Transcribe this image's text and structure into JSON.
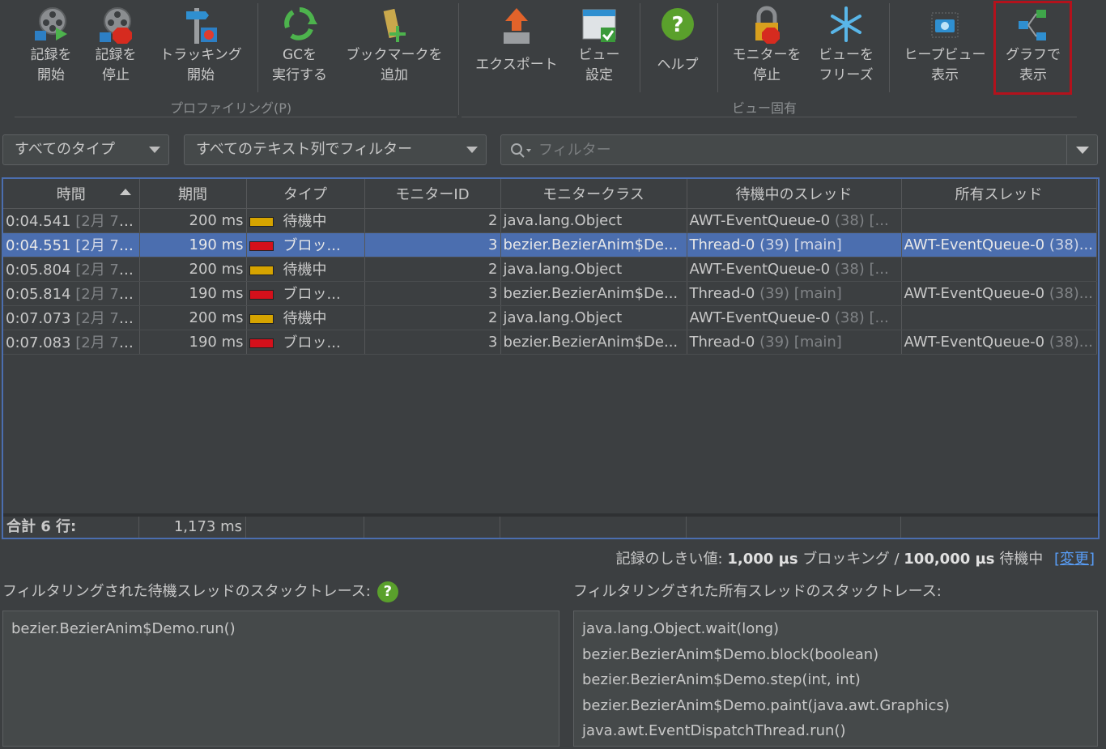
{
  "toolbar": {
    "start_recording": "記録を\n開始",
    "stop_recording": "記録を\n停止",
    "start_tracking": "トラッキング\n開始",
    "run_gc": "GCを\n実行する",
    "add_bookmark": "ブックマークを\n追加",
    "export": "エクスポート",
    "view_settings": "ビュー\n設定",
    "help": "ヘルプ",
    "stop_monitor": "モニターを\n停止",
    "freeze_view": "ビューを\nフリーズ",
    "show_heap_view": "ヒープビュー\n表示",
    "show_graph": "グラフで\n表示",
    "group_profiling": "プロファイリング(P)",
    "group_view_specific": "ビュー固有"
  },
  "filters": {
    "type_select": "すべてのタイプ",
    "text_column_select": "すべてのテキスト列でフィルター",
    "search_placeholder": "フィルター"
  },
  "table": {
    "columns": [
      "時間",
      "期間",
      "タイプ",
      "モニターID",
      "モニタークラス",
      "待機中のスレッド",
      "所有スレッド"
    ],
    "rows": [
      {
        "time": "0:04.541",
        "date": "[2月 7, ...",
        "duration": "200 ms",
        "type": "wait",
        "type_label": "待機中",
        "monitor_id": "2",
        "monitor_class": "java.lang.Object",
        "waiting_thread": "AWT-EventQueue-0",
        "waiting_extra": "(38) [...",
        "owning_thread": "",
        "owning_extra": "",
        "selected": false
      },
      {
        "time": "0:04.551",
        "date": "[2月 7, ...",
        "duration": "190 ms",
        "type": "block",
        "type_label": "ブロッ...",
        "monitor_id": "3",
        "monitor_class": "bezier.BezierAnim$De...",
        "waiting_thread": "Thread-0",
        "waiting_extra": "(39) [main]",
        "owning_thread": "AWT-EventQueue-0",
        "owning_extra": "(38)...",
        "selected": true
      },
      {
        "time": "0:05.804",
        "date": "[2月 7, ...",
        "duration": "200 ms",
        "type": "wait",
        "type_label": "待機中",
        "monitor_id": "2",
        "monitor_class": "java.lang.Object",
        "waiting_thread": "AWT-EventQueue-0",
        "waiting_extra": "(38) [...",
        "owning_thread": "",
        "owning_extra": "",
        "selected": false
      },
      {
        "time": "0:05.814",
        "date": "[2月 7, ...",
        "duration": "190 ms",
        "type": "block",
        "type_label": "ブロッ...",
        "monitor_id": "3",
        "monitor_class": "bezier.BezierAnim$De...",
        "waiting_thread": "Thread-0",
        "waiting_extra": "(39) [main]",
        "owning_thread": "AWT-EventQueue-0",
        "owning_extra": "(38)...",
        "selected": false
      },
      {
        "time": "0:07.073",
        "date": "[2月 7, ...",
        "duration": "200 ms",
        "type": "wait",
        "type_label": "待機中",
        "monitor_id": "2",
        "monitor_class": "java.lang.Object",
        "waiting_thread": "AWT-EventQueue-0",
        "waiting_extra": "(38) [...",
        "owning_thread": "",
        "owning_extra": "",
        "selected": false
      },
      {
        "time": "0:07.083",
        "date": "[2月 7, ...",
        "duration": "190 ms",
        "type": "block",
        "type_label": "ブロッ...",
        "monitor_id": "3",
        "monitor_class": "bezier.BezierAnim$De...",
        "waiting_thread": "Thread-0",
        "waiting_extra": "(39) [main]",
        "owning_thread": "AWT-EventQueue-0",
        "owning_extra": "(38)...",
        "selected": false
      }
    ],
    "total_label": "合計 6 行:",
    "total_duration": "1,173 ms"
  },
  "threshold": {
    "prefix": "記録のしきい値:",
    "blocking_value": "1,000 µs",
    "blocking_label": "ブロッキング /",
    "waiting_value": "100,000 µs",
    "waiting_label": "待機中",
    "change_link": "[変更]"
  },
  "stack": {
    "waiting_label": "フィルタリングされた待機スレッドのスタックトレース:",
    "owning_label": "フィルタリングされた所有スレッドのスタックトレース:",
    "waiting_frames": [
      "bezier.BezierAnim$Demo.run()"
    ],
    "owning_frames": [
      "java.lang.Object.wait(long)",
      "bezier.BezierAnim$Demo.block(boolean)",
      "bezier.BezierAnim$Demo.step(int, int)",
      "bezier.BezierAnim$Demo.paint(java.awt.Graphics)",
      "java.awt.EventDispatchThread.run()"
    ]
  },
  "colors": {
    "wait_swatch": "#d6a400",
    "block_swatch": "#d5101b",
    "selection": "#4b6eaf",
    "highlight_box": "#b3121c"
  }
}
